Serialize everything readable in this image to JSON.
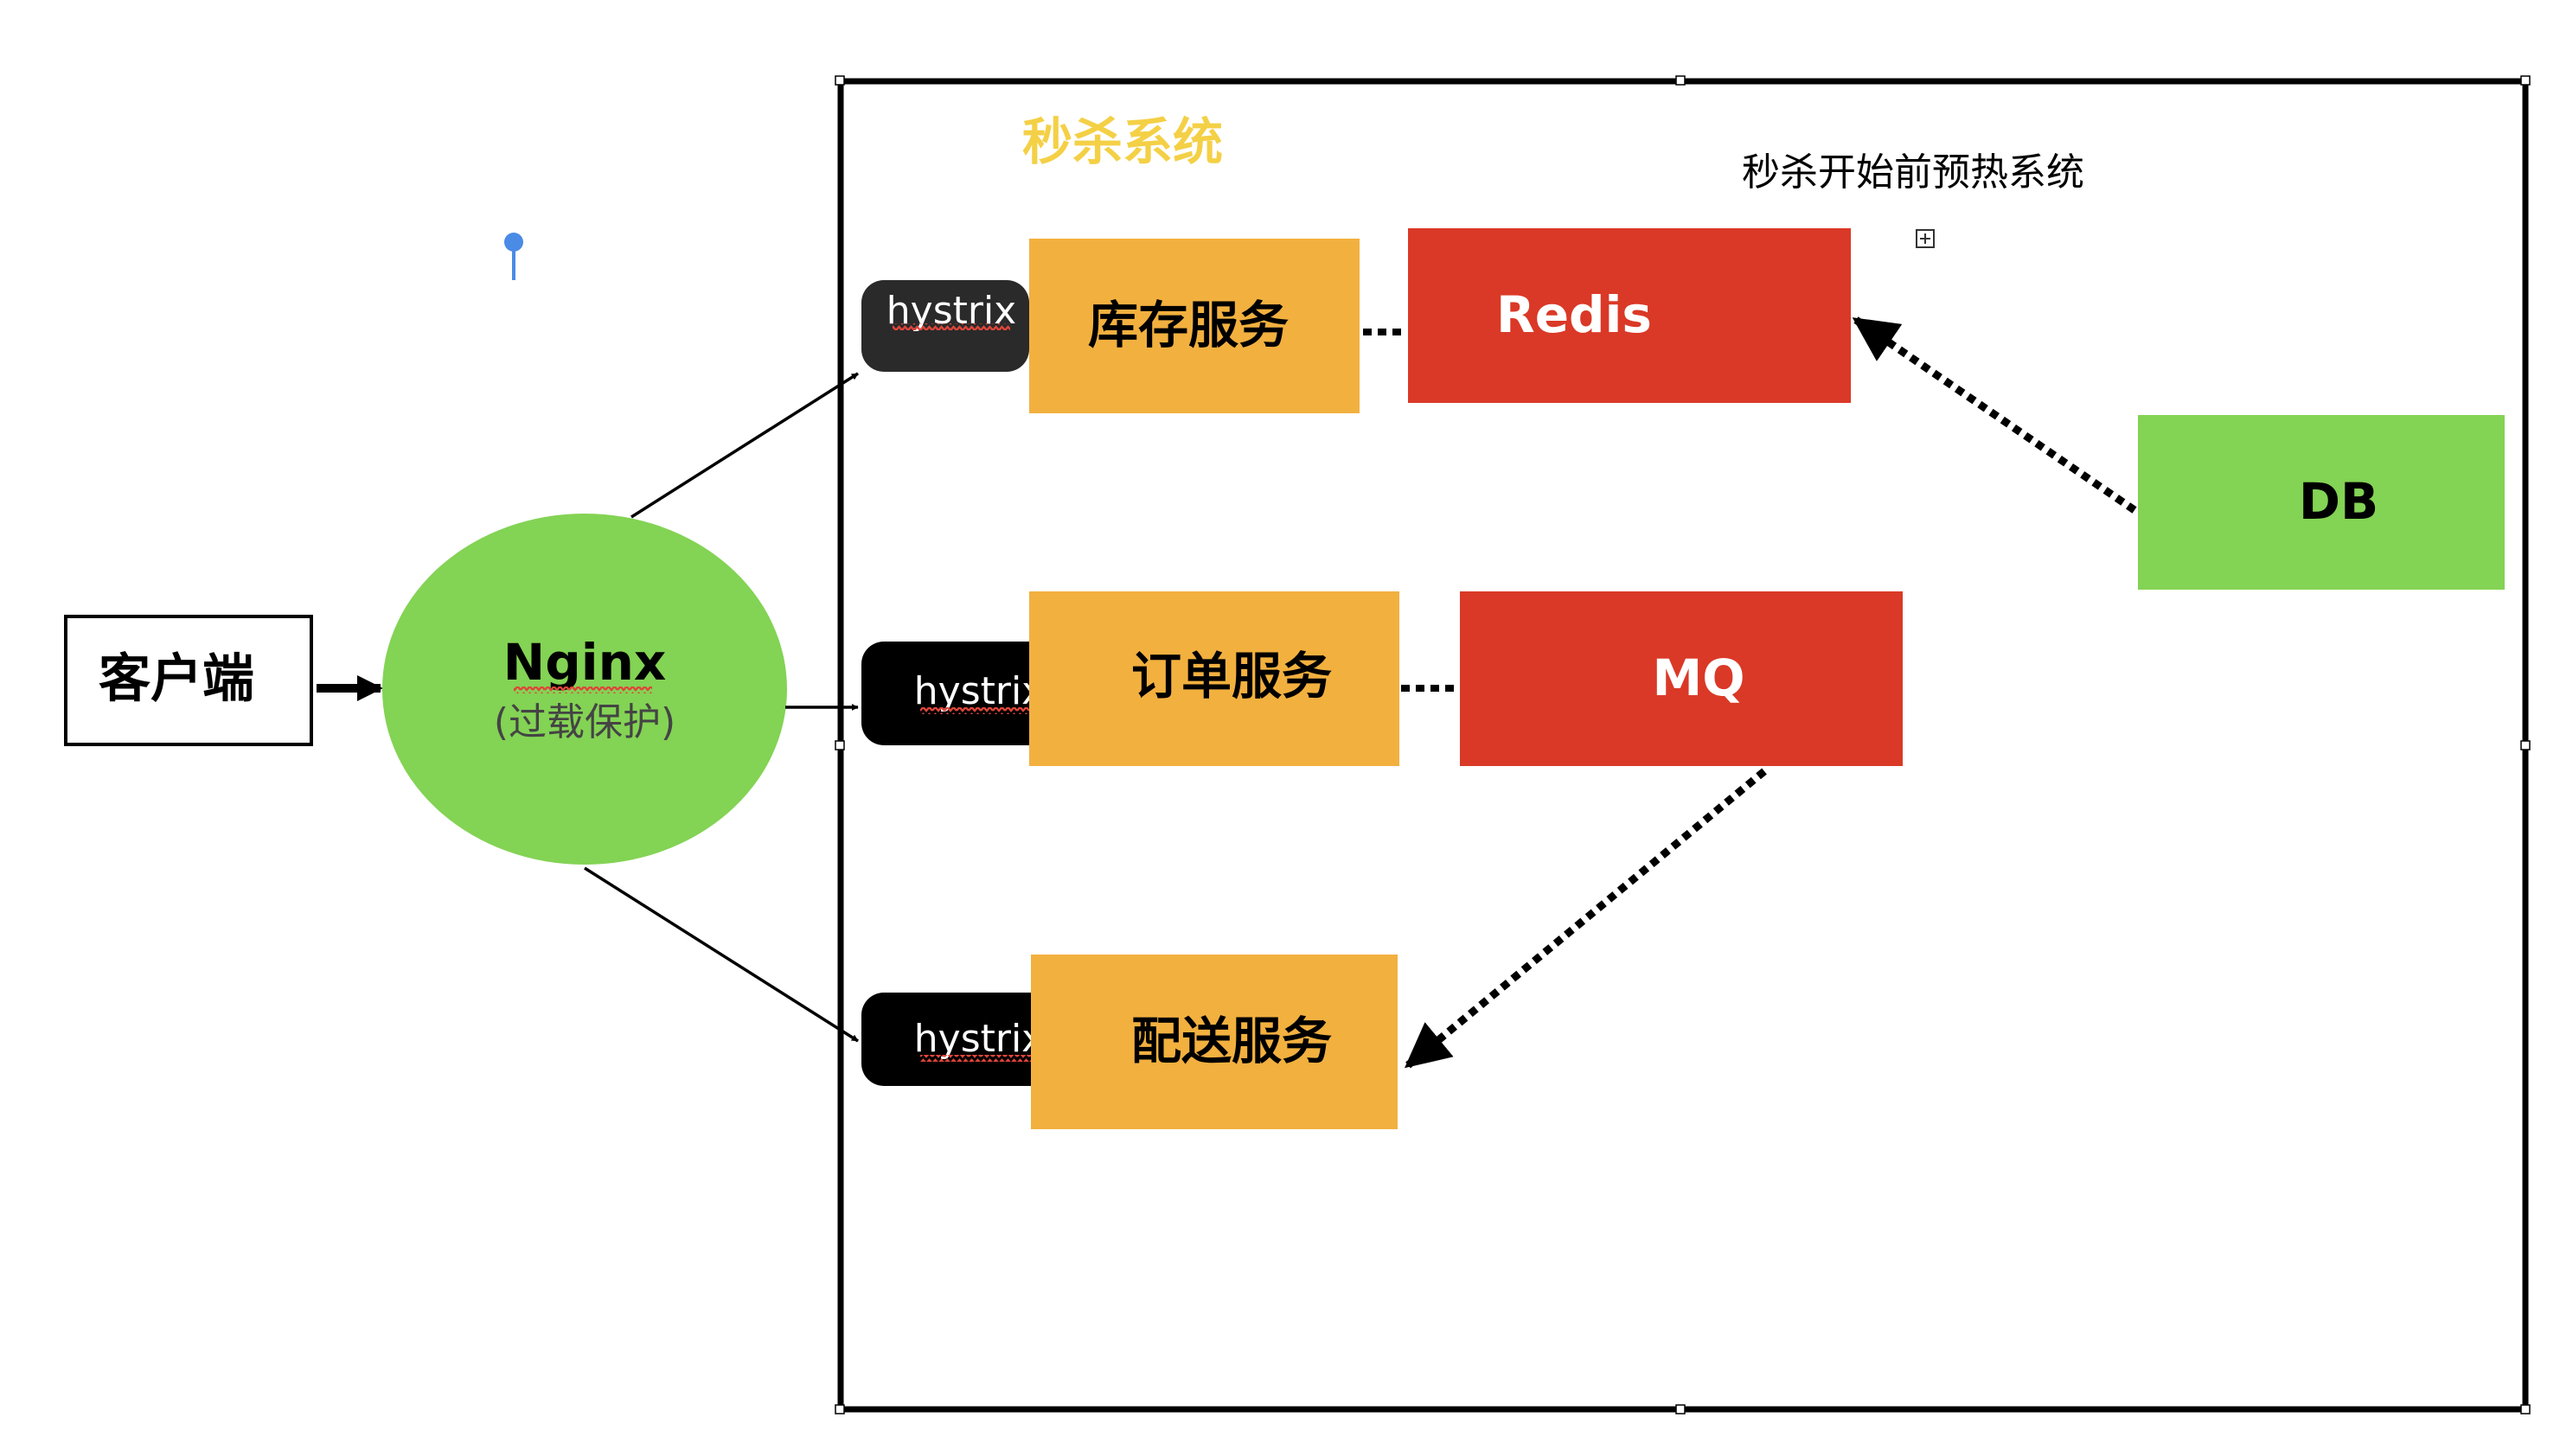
{
  "client": {
    "label": "客户端"
  },
  "nginx": {
    "title": "Nginx",
    "subtitle": "(过载保护)"
  },
  "system": {
    "title": "秒杀系统",
    "preheat_label": "秒杀开始前预热系统"
  },
  "hystrix": {
    "label": "hystrix"
  },
  "services": {
    "inventory": "库存服务",
    "order": "订单服务",
    "delivery": "配送服务"
  },
  "stores": {
    "redis": "Redis",
    "mq": "MQ",
    "db": "DB"
  },
  "colors": {
    "service": "#F2B03F",
    "store": "#DA3927",
    "nginx": "#83D354",
    "db": "#83D354",
    "title": "#F4D046",
    "hystrix_dark": "#2A2A2A",
    "hystrix_black": "#000000",
    "squiggle": "#E0453A",
    "pin": "#4A8BE6"
  },
  "icons": {
    "pin": "location-pin-icon",
    "expand": "expand-plus-icon"
  }
}
